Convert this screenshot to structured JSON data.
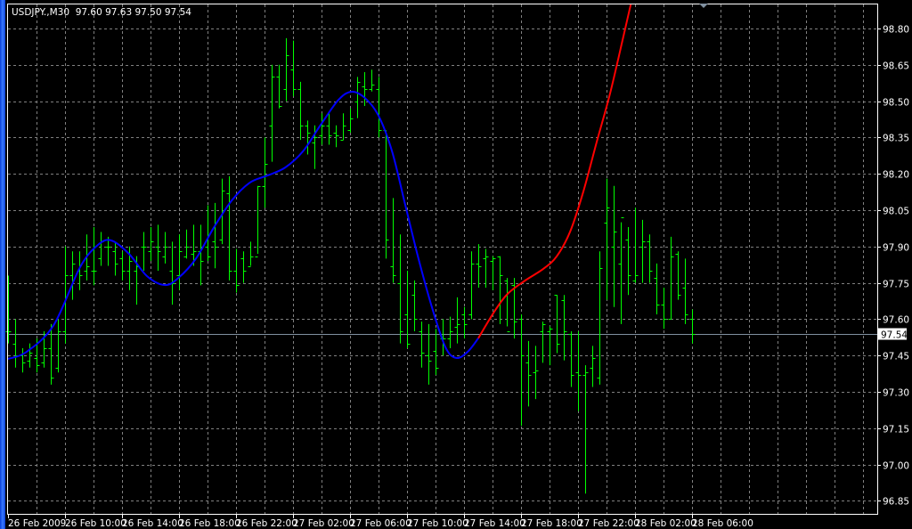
{
  "chart_data": {
    "type": "line",
    "title": "USDJPY.,M30  97.60 97.63 97.50 97.54",
    "symbol": "USDJPY.",
    "timeframe": "M30",
    "ohlc_header": {
      "open": "97.60",
      "high": "97.63",
      "low": "97.50",
      "close": "97.54"
    },
    "current_price_label": "97.54",
    "current_price": 97.54,
    "ylim": [
      96.796,
      98.903
    ],
    "y_ticks": [
      "98.80",
      "98.65",
      "98.50",
      "98.35",
      "98.20",
      "98.05",
      "97.90",
      "97.75",
      "97.60",
      "97.45",
      "97.30",
      "97.15",
      "97.00",
      "96.85"
    ],
    "x_ticks": [
      "26 Feb 2009",
      "26 Feb 10:00",
      "26 Feb 14:00",
      "26 Feb 18:00",
      "26 Feb 22:00",
      "27 Feb 02:00",
      "27 Feb 06:00",
      "27 Feb 10:00",
      "27 Feb 14:00",
      "27 Feb 18:00",
      "27 Feb 22:00",
      "28 Feb 02:00",
      "28 Feb 06:00"
    ],
    "grid": true,
    "colors": {
      "bars": "#00ff00",
      "fit_line": "#0000ff",
      "forecast_line": "#ff0000",
      "grid": "#808080",
      "price_line": "#8090a0"
    },
    "bars_ohlc": [
      [
        97.55,
        97.78,
        97.5,
        97.55
      ],
      [
        97.5,
        97.6,
        97.4,
        97.45
      ],
      [
        97.45,
        97.48,
        97.38,
        97.42
      ],
      [
        97.43,
        97.5,
        97.4,
        97.46
      ],
      [
        97.44,
        97.52,
        97.38,
        97.41
      ],
      [
        97.42,
        97.55,
        97.4,
        97.48
      ],
      [
        97.48,
        97.58,
        97.33,
        97.36
      ],
      [
        97.4,
        97.6,
        97.38,
        97.55
      ],
      [
        97.55,
        97.9,
        97.5,
        97.78
      ],
      [
        97.78,
        97.88,
        97.68,
        97.83
      ],
      [
        97.8,
        97.88,
        97.72,
        97.78
      ],
      [
        97.8,
        97.95,
        97.76,
        97.82
      ],
      [
        97.8,
        97.98,
        97.74,
        97.8
      ],
      [
        97.85,
        97.96,
        97.82,
        97.92
      ],
      [
        97.9,
        97.94,
        97.82,
        97.9
      ],
      [
        97.88,
        97.92,
        97.78,
        97.83
      ],
      [
        97.85,
        97.88,
        97.76,
        97.8
      ],
      [
        97.8,
        97.9,
        97.72,
        97.84
      ],
      [
        97.8,
        97.86,
        97.66,
        97.82
      ],
      [
        97.9,
        97.96,
        97.8,
        97.9
      ],
      [
        97.88,
        97.98,
        97.84,
        97.92
      ],
      [
        97.9,
        97.99,
        97.8,
        97.88
      ],
      [
        97.86,
        97.96,
        97.83,
        97.9
      ],
      [
        97.8,
        97.92,
        97.66,
        97.75
      ],
      [
        97.78,
        97.95,
        97.72,
        97.88
      ],
      [
        97.86,
        97.97,
        97.85,
        97.9
      ],
      [
        97.87,
        97.99,
        97.82,
        97.88
      ],
      [
        97.88,
        97.99,
        97.74,
        97.84
      ],
      [
        97.9,
        98.07,
        97.84,
        97.86
      ],
      [
        97.92,
        98.08,
        97.81,
        97.9
      ],
      [
        97.93,
        98.18,
        97.91,
        98.13
      ],
      [
        98.12,
        98.19,
        97.76,
        97.8
      ],
      [
        97.8,
        97.89,
        97.71,
        97.74
      ],
      [
        97.85,
        97.88,
        97.75,
        97.8
      ],
      [
        97.82,
        97.92,
        97.82,
        97.86
      ],
      [
        97.86,
        98.15,
        97.87,
        98.15
      ],
      [
        98.15,
        98.35,
        98.06,
        98.24
      ],
      [
        98.4,
        98.65,
        98.25,
        98.6
      ],
      [
        98.6,
        98.65,
        98.47,
        98.48
      ],
      [
        98.55,
        98.76,
        98.5,
        98.69
      ],
      [
        98.63,
        98.75,
        98.52,
        98.55
      ],
      [
        98.55,
        98.58,
        98.34,
        98.4
      ],
      [
        98.4,
        98.42,
        98.28,
        98.37
      ],
      [
        98.33,
        98.4,
        98.22,
        98.35
      ],
      [
        98.36,
        98.45,
        98.32,
        98.4
      ],
      [
        98.4,
        98.45,
        98.32,
        98.36
      ],
      [
        98.37,
        98.4,
        98.31,
        98.36
      ],
      [
        98.34,
        98.45,
        98.34,
        98.4
      ],
      [
        98.38,
        98.47,
        98.37,
        98.43
      ],
      [
        98.5,
        98.6,
        98.43,
        98.58
      ],
      [
        98.56,
        98.62,
        98.48,
        98.55
      ],
      [
        98.55,
        98.63,
        98.54,
        98.57
      ],
      [
        98.55,
        98.6,
        98.35,
        98.38
      ],
      [
        98.38,
        98.38,
        97.85,
        97.93
      ],
      [
        97.82,
        98.1,
        97.75,
        97.78
      ],
      [
        97.75,
        97.95,
        97.5,
        97.55
      ],
      [
        97.62,
        97.8,
        97.48,
        97.5
      ],
      [
        97.7,
        97.76,
        97.55,
        97.6
      ],
      [
        97.55,
        97.59,
        97.4,
        97.46
      ],
      [
        97.45,
        97.58,
        97.33,
        97.43
      ],
      [
        97.47,
        97.56,
        97.37,
        97.4
      ],
      [
        97.52,
        97.6,
        97.45,
        97.52
      ],
      [
        97.52,
        97.61,
        97.48,
        97.55
      ],
      [
        97.57,
        97.69,
        97.5,
        97.58
      ],
      [
        97.62,
        97.65,
        97.52,
        97.58
      ],
      [
        97.62,
        97.88,
        97.6,
        97.83
      ],
      [
        97.83,
        97.91,
        97.73,
        97.82
      ],
      [
        97.85,
        97.89,
        97.73,
        97.86
      ],
      [
        97.84,
        97.86,
        97.72,
        97.85
      ],
      [
        97.86,
        97.86,
        97.58,
        97.78
      ],
      [
        97.76,
        97.77,
        97.57,
        97.55
      ],
      [
        97.74,
        97.77,
        97.52,
        97.59
      ],
      [
        97.6,
        97.62,
        97.16,
        97.45
      ],
      [
        97.42,
        97.51,
        97.24,
        97.37
      ],
      [
        97.38,
        97.49,
        97.27,
        97.39
      ],
      [
        97.55,
        97.59,
        97.42,
        97.58
      ],
      [
        97.55,
        97.57,
        97.41,
        97.56
      ],
      [
        97.7,
        97.7,
        97.46,
        97.5
      ],
      [
        97.68,
        97.7,
        97.43,
        97.55
      ],
      [
        97.54,
        97.55,
        97.32,
        97.37
      ],
      [
        97.38,
        97.55,
        97.22,
        97.37
      ],
      [
        97.37,
        97.41,
        96.88,
        97.38
      ],
      [
        97.4,
        97.49,
        97.32,
        97.44
      ],
      [
        97.36,
        97.88,
        97.33,
        97.81
      ],
      [
        98.0,
        98.18,
        97.68,
        98.06
      ],
      [
        97.9,
        98.15,
        97.65,
        97.96
      ],
      [
        97.83,
        98.0,
        97.58,
        98.02
      ],
      [
        97.93,
        97.98,
        97.7,
        97.78
      ],
      [
        97.76,
        98.06,
        97.75,
        97.78
      ],
      [
        97.9,
        98.01,
        97.75,
        97.92
      ],
      [
        97.92,
        97.95,
        97.75,
        97.8
      ],
      [
        97.77,
        97.83,
        97.62,
        97.66
      ],
      [
        97.66,
        97.73,
        97.56,
        97.6
      ],
      [
        97.6,
        97.94,
        97.6,
        97.86
      ],
      [
        97.87,
        97.88,
        97.68,
        97.7
      ],
      [
        97.73,
        97.85,
        97.58,
        97.62
      ],
      [
        97.6,
        97.64,
        97.5,
        97.54
      ]
    ],
    "fit_curve": [
      [
        0,
        97.436
      ],
      [
        2.6,
        97.465
      ],
      [
        6.4,
        97.575
      ],
      [
        10.1,
        97.814
      ],
      [
        12.6,
        97.906
      ],
      [
        14.5,
        97.925
      ],
      [
        17,
        97.869
      ],
      [
        19.5,
        97.778
      ],
      [
        22,
        97.741
      ],
      [
        23.9,
        97.77
      ],
      [
        26.4,
        97.851
      ],
      [
        28.9,
        97.979
      ],
      [
        31.4,
        98.09
      ],
      [
        33.9,
        98.163
      ],
      [
        36.4,
        98.193
      ],
      [
        38.9,
        98.226
      ],
      [
        41.4,
        98.293
      ],
      [
        43.9,
        98.403
      ],
      [
        46.4,
        98.506
      ],
      [
        48.25,
        98.539
      ],
      [
        50.1,
        98.513
      ],
      [
        52,
        98.44
      ],
      [
        53.9,
        98.293
      ],
      [
        55.75,
        98.072
      ],
      [
        57.6,
        97.851
      ],
      [
        59.5,
        97.649
      ],
      [
        61.4,
        97.484
      ],
      [
        62.9,
        97.44
      ],
      [
        64.5,
        97.465
      ],
      [
        66,
        97.521
      ]
    ],
    "forecast_curve": [
      [
        66,
        97.521
      ],
      [
        68.25,
        97.631
      ],
      [
        70.1,
        97.704
      ],
      [
        72.6,
        97.76
      ],
      [
        75.1,
        97.807
      ],
      [
        77,
        97.859
      ],
      [
        78.9,
        97.962
      ],
      [
        80.75,
        98.127
      ],
      [
        82.6,
        98.329
      ],
      [
        84.5,
        98.532
      ],
      [
        86.4,
        98.771
      ],
      [
        87.4,
        98.899
      ]
    ]
  }
}
